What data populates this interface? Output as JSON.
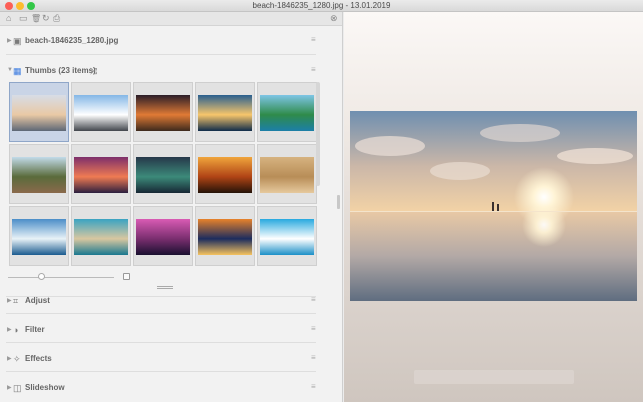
{
  "window": {
    "title": "beach-1846235_1280.jpg - 13.01.2019",
    "colors": {
      "close": "#fc5f57",
      "minimize": "#fdbc2e",
      "zoom": "#33c748"
    }
  },
  "toolbar": {
    "icons": {
      "home": "⌂",
      "folder": "▭",
      "trash": "🗑",
      "refresh": "↻",
      "print": "⎙",
      "close": "⊗"
    }
  },
  "sections": {
    "file": {
      "label": "beach-1846235_1280.jpg",
      "icon": "▣"
    },
    "thumbs": {
      "label": "Thumbs (23 items)",
      "icon": "▦",
      "shuffle": "⤨"
    },
    "adjust": {
      "label": "Adjust",
      "icon": "⌗"
    },
    "filter": {
      "label": "Filter",
      "icon": "◑"
    },
    "effects": {
      "label": "Effects",
      "icon": "✧"
    },
    "slideshow": {
      "label": "Slideshow",
      "icon": "◫"
    }
  },
  "thumbnails": [
    {
      "name": "beach-sunset-calm",
      "colors": [
        "#d7dde6",
        "#e9c9a5",
        "#5d6775"
      ]
    },
    {
      "name": "rocky-shore",
      "colors": [
        "#84b7e6",
        "#ffffff",
        "#42464c"
      ]
    },
    {
      "name": "rocks-at-dusk",
      "colors": [
        "#2a1d28",
        "#e07a35",
        "#3d2a1d"
      ]
    },
    {
      "name": "ocean-sunrise",
      "colors": [
        "#2a5f8f",
        "#f7c66b",
        "#0f2c4a"
      ]
    },
    {
      "name": "tropical-bay",
      "colors": [
        "#7ec5e6",
        "#2f8b4a",
        "#1c7fa8"
      ]
    },
    {
      "name": "palm-beach-sunset",
      "colors": [
        "#c2dbe9",
        "#5a6b3b",
        "#8b6a4b"
      ]
    },
    {
      "name": "purple-sunset-pier",
      "colors": [
        "#7d2f6b",
        "#ef7b53",
        "#2b1f3f"
      ]
    },
    {
      "name": "stormy-sea",
      "colors": [
        "#26384a",
        "#3c8a7a",
        "#172734"
      ]
    },
    {
      "name": "palm-silhouette",
      "colors": [
        "#f0a53c",
        "#b04415",
        "#241208"
      ]
    },
    {
      "name": "sand-texture",
      "colors": [
        "#d6b380",
        "#b88d57",
        "#e6c99d"
      ]
    },
    {
      "name": "blue-wave",
      "colors": [
        "#4b8dc8",
        "#e8f2f7",
        "#1b5b8f"
      ]
    },
    {
      "name": "aerial-shoreline",
      "colors": [
        "#3aa3c2",
        "#d8c7a0",
        "#19788f"
      ]
    },
    {
      "name": "magenta-sky",
      "colors": [
        "#d95bb4",
        "#7a2e6f",
        "#1a1030"
      ]
    },
    {
      "name": "jellyfish",
      "colors": [
        "#e7822b",
        "#1c2c5e",
        "#f6c35f"
      ]
    },
    {
      "name": "palm-hammock",
      "colors": [
        "#28a9df",
        "#ffffff",
        "#1b8fc7"
      ]
    }
  ],
  "preview": {
    "title": "beach at sunset, calm water reflection"
  }
}
